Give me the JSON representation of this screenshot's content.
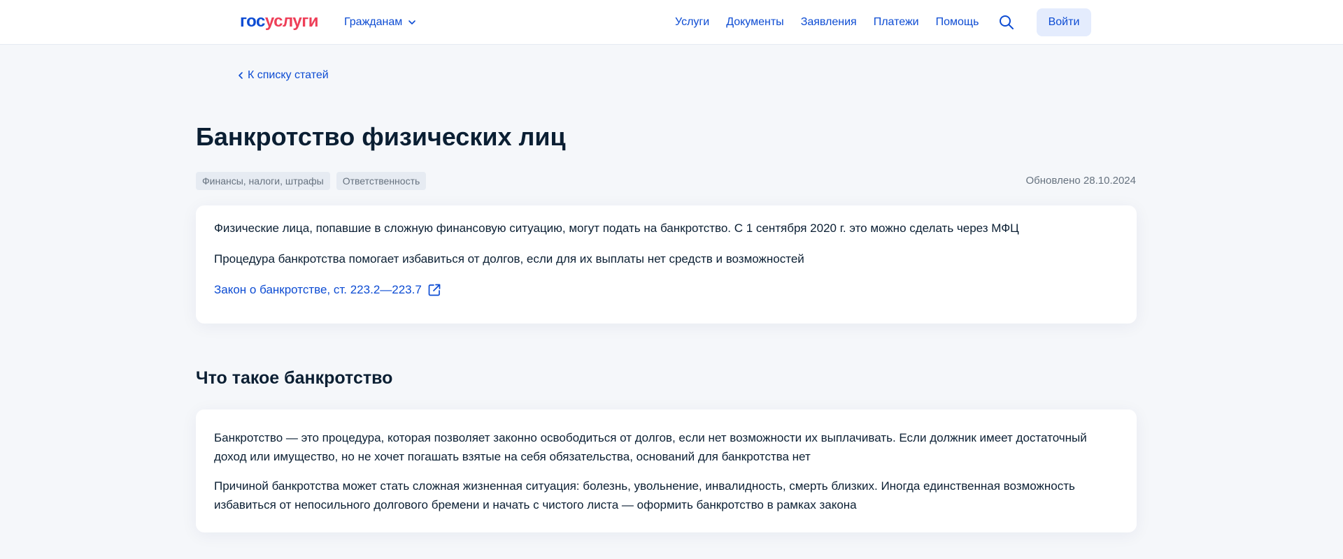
{
  "header": {
    "logo_part1": "гос",
    "logo_part2": "услуги",
    "citizen_menu": "Гражданам",
    "nav": [
      "Услуги",
      "Документы",
      "Заявления",
      "Платежи",
      "Помощь"
    ],
    "login_label": "Войти"
  },
  "back_link": "К списку статей",
  "title": "Банкротство физических лиц",
  "tags": [
    "Финансы, налоги, штрафы",
    "Ответственность"
  ],
  "updated": "Обновлено 28.10.2024",
  "intro": {
    "p1": "Физические лица, попавшие в сложную финансовую ситуацию, могут подать на банкротство. С 1 сентября 2020 г. это можно сделать через МФЦ",
    "p2": "Процедура банкротства помогает избавиться от долгов, если для их выплаты нет средств и возможностей",
    "law_link": "Закон о банкротстве, ст. 223.2—223.7"
  },
  "section": {
    "title": "Что такое банкротство",
    "p1": "Банкротство — это процедура, которая позволяет законно освободиться от долгов, если нет возможности их выплачивать. Если должник имеет достаточный доход или имущество, но не хочет погашать взятые на себя обязательства, оснований для банкротства нет",
    "p2": "Причиной банкротства может стать сложная жизненная ситуация: болезнь, увольнение, инвалидность, смерть близких. Иногда единственная возможность избавиться от непосильного долгового бремени и начать с чистого листа — оформить банкротство в рамках закона"
  },
  "colors": {
    "brand_blue": "#0d4cd3",
    "brand_red": "#ee3f58",
    "page_bg": "#f5f7fa"
  },
  "icons": [
    "chevron-down-icon",
    "search-icon",
    "chevron-left-icon",
    "external-link-icon"
  ]
}
